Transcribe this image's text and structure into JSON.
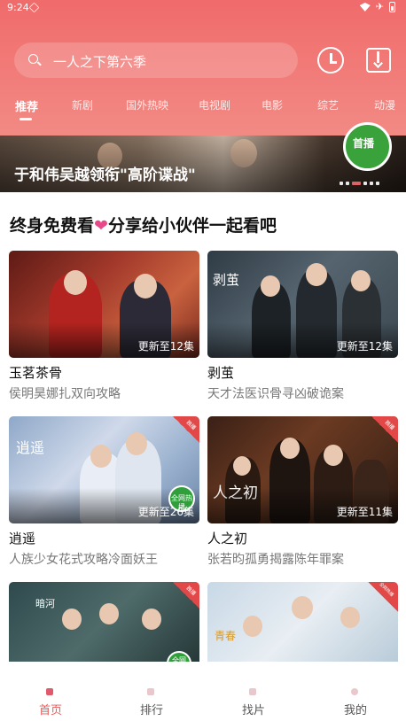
{
  "status_bar": {
    "time": "9:24"
  },
  "search": {
    "placeholder": "一人之下第六季"
  },
  "tabs": [
    {
      "label": "推荐",
      "active": true
    },
    {
      "label": "新剧"
    },
    {
      "label": "国外热映"
    },
    {
      "label": "电视剧"
    },
    {
      "label": "电影"
    },
    {
      "label": "综艺"
    },
    {
      "label": "动漫"
    }
  ],
  "banner": {
    "title": "于和伟吴越领衔\"高阶谍战\"",
    "badge": "首播",
    "dots": 6,
    "active_dot": 3
  },
  "promo": {
    "before": "终身免费看",
    "heart": "❤",
    "after": "分享给小伙伴一起看吧"
  },
  "cards": [
    {
      "title": "玉茗茶骨",
      "subtitle": "侯明昊娜扎双向攻略",
      "episodes": "更新至12集"
    },
    {
      "title": "剥茧",
      "subtitle": "天才法医识骨寻凶破诡案",
      "episodes": "更新至12集",
      "poster_text": "剥茧"
    },
    {
      "title": "逍遥",
      "subtitle": "人族少女花式攻略冷面妖王",
      "episodes": "更新至26集",
      "corner": "独播",
      "sticker": "全网热播",
      "poster_text": "逍遥"
    },
    {
      "title": "人之初",
      "subtitle": "张若昀孤勇揭露陈年罪案",
      "episodes": "更新至11集",
      "corner": "独播",
      "poster_text": "人之初"
    },
    {
      "title": "",
      "subtitle": "",
      "episodes": "",
      "corner": "独播",
      "sticker": "全网",
      "poster_text": "暗河"
    },
    {
      "title": "",
      "subtitle": "",
      "episodes": "",
      "corner": "全网热播",
      "poster_text": "青春"
    }
  ],
  "bottom_nav": [
    {
      "label": "首页",
      "active": true
    },
    {
      "label": "排行"
    },
    {
      "label": "找片"
    },
    {
      "label": "我的"
    }
  ],
  "colors": {
    "accent": "#f06b6b",
    "nav_active": "#e85a5a",
    "heart": "#e8478a"
  }
}
